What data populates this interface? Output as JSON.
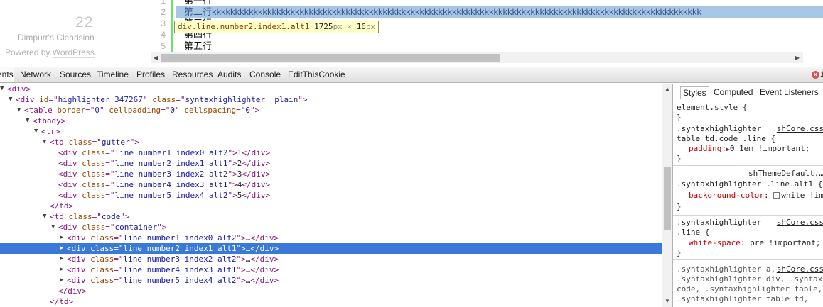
{
  "sidebar": {
    "count": "22",
    "site_name": "Dimpurr's Clearision",
    "powered_prefix": "Powered by ",
    "powered_link": "WordPress"
  },
  "code_box": {
    "line_numbers": [
      "1",
      "2",
      "3",
      "4",
      "5"
    ],
    "lines": [
      "第一行",
      "第二行kkkkkkkkkkkkkkkkkkkkkkkkkkkkkkkkkkkkkkkkkkkkkkkkkkkkkkkkkkkkkkkkkkkkkkkkkkkkkkkkkkkkkkkkkkkkkkkkkkkkkkkkkk",
      "第三行",
      "第四行",
      "第五行"
    ],
    "horizontal_scroll_fraction": 0.52
  },
  "tooltip": {
    "selector": "div.line.number2.index1.alt1",
    "width": "1725",
    "width_unit": "px",
    "times": "×",
    "height": "16",
    "height_unit": "px"
  },
  "devtools": {
    "tabs": [
      "ents",
      "Network",
      "Sources",
      "Timeline",
      "Profiles",
      "Resources",
      "Audits",
      "Console",
      "EditThisCookie"
    ],
    "error_count": "1",
    "dom_rows": [
      {
        "triangle": "open",
        "parts": [
          [
            "tg",
            "<div>"
          ]
        ]
      },
      {
        "triangle": "open",
        "parts": [
          [
            "tg",
            "<div "
          ],
          [
            "an",
            "id"
          ],
          [
            "tg",
            "=\""
          ],
          [
            "av",
            "highlighter_347267"
          ],
          [
            "tg",
            "\" "
          ],
          [
            "an",
            "class"
          ],
          [
            "tg",
            "=\""
          ],
          [
            "av",
            "syntaxhighlighter  plain"
          ],
          [
            "tg",
            "\">"
          ]
        ]
      },
      {
        "triangle": "open",
        "parts": [
          [
            "tg",
            "<table "
          ],
          [
            "an",
            "border"
          ],
          [
            "tg",
            "=\""
          ],
          [
            "av",
            "0"
          ],
          [
            "tg",
            "\" "
          ],
          [
            "an",
            "cellpadding"
          ],
          [
            "tg",
            "=\""
          ],
          [
            "av",
            "0"
          ],
          [
            "tg",
            "\" "
          ],
          [
            "an",
            "cellspacing"
          ],
          [
            "tg",
            "=\""
          ],
          [
            "av",
            "0"
          ],
          [
            "tg",
            "\">"
          ]
        ]
      },
      {
        "triangle": "open",
        "parts": [
          [
            "tg",
            "<tbody>"
          ]
        ]
      },
      {
        "triangle": "open",
        "parts": [
          [
            "tg",
            "<tr>"
          ]
        ]
      },
      {
        "triangle": "open",
        "parts": [
          [
            "tg",
            "<td "
          ],
          [
            "an",
            "class"
          ],
          [
            "tg",
            "=\""
          ],
          [
            "av",
            "gutter"
          ],
          [
            "tg",
            "\">"
          ]
        ]
      },
      {
        "triangle": "none",
        "parts": [
          [
            "tg",
            "<div "
          ],
          [
            "an",
            "class"
          ],
          [
            "tg",
            "=\""
          ],
          [
            "av",
            "line number1 index0 alt2"
          ],
          [
            "tg",
            "\">"
          ],
          [
            "tx",
            "1"
          ],
          [
            "tg",
            "</div>"
          ]
        ]
      },
      {
        "triangle": "none",
        "parts": [
          [
            "tg",
            "<div "
          ],
          [
            "an",
            "class"
          ],
          [
            "tg",
            "=\""
          ],
          [
            "av",
            "line number2 index1 alt1"
          ],
          [
            "tg",
            "\">"
          ],
          [
            "tx",
            "2"
          ],
          [
            "tg",
            "</div>"
          ]
        ]
      },
      {
        "triangle": "none",
        "parts": [
          [
            "tg",
            "<div "
          ],
          [
            "an",
            "class"
          ],
          [
            "tg",
            "=\""
          ],
          [
            "av",
            "line number3 index2 alt2"
          ],
          [
            "tg",
            "\">"
          ],
          [
            "tx",
            "3"
          ],
          [
            "tg",
            "</div>"
          ]
        ]
      },
      {
        "triangle": "none",
        "parts": [
          [
            "tg",
            "<div "
          ],
          [
            "an",
            "class"
          ],
          [
            "tg",
            "=\""
          ],
          [
            "av",
            "line number4 index3 alt1"
          ],
          [
            "tg",
            "\">"
          ],
          [
            "tx",
            "4"
          ],
          [
            "tg",
            "</div>"
          ]
        ]
      },
      {
        "triangle": "none",
        "parts": [
          [
            "tg",
            "<div "
          ],
          [
            "an",
            "class"
          ],
          [
            "tg",
            "=\""
          ],
          [
            "av",
            "line number5 index4 alt2"
          ],
          [
            "tg",
            "\">"
          ],
          [
            "tx",
            "5"
          ],
          [
            "tg",
            "</div>"
          ]
        ]
      },
      {
        "triangle": "none",
        "parts": [
          [
            "tg",
            "</td>"
          ]
        ]
      },
      {
        "triangle": "open",
        "parts": [
          [
            "tg",
            "<td "
          ],
          [
            "an",
            "class"
          ],
          [
            "tg",
            "=\""
          ],
          [
            "av",
            "code"
          ],
          [
            "tg",
            "\">"
          ]
        ]
      },
      {
        "triangle": "open",
        "parts": [
          [
            "tg",
            "<div "
          ],
          [
            "an",
            "class"
          ],
          [
            "tg",
            "=\""
          ],
          [
            "av",
            "container"
          ],
          [
            "tg",
            "\">"
          ]
        ]
      },
      {
        "triangle": "closed",
        "parts": [
          [
            "tg",
            "<div "
          ],
          [
            "an",
            "class"
          ],
          [
            "tg",
            "=\""
          ],
          [
            "av",
            "line number1 index0 alt2"
          ],
          [
            "tg",
            "\">"
          ],
          [
            "tx",
            "…"
          ],
          [
            "tg",
            "</div>"
          ]
        ]
      },
      {
        "triangle": "closed",
        "selected": true,
        "parts": [
          [
            "tg",
            "<div "
          ],
          [
            "an",
            "class"
          ],
          [
            "tg",
            "=\""
          ],
          [
            "av",
            "line number2 index1 alt1"
          ],
          [
            "tg",
            "\">"
          ],
          [
            "tx",
            "…"
          ],
          [
            "tg",
            "</div>"
          ]
        ]
      },
      {
        "triangle": "closed",
        "parts": [
          [
            "tg",
            "<div "
          ],
          [
            "an",
            "class"
          ],
          [
            "tg",
            "=\""
          ],
          [
            "av",
            "line number3 index2 alt2"
          ],
          [
            "tg",
            "\">"
          ],
          [
            "tx",
            "…"
          ],
          [
            "tg",
            "</div>"
          ]
        ]
      },
      {
        "triangle": "closed",
        "parts": [
          [
            "tg",
            "<div "
          ],
          [
            "an",
            "class"
          ],
          [
            "tg",
            "=\""
          ],
          [
            "av",
            "line number4 index3 alt1"
          ],
          [
            "tg",
            "\">"
          ],
          [
            "tx",
            "…"
          ],
          [
            "tg",
            "</div>"
          ]
        ]
      },
      {
        "triangle": "closed",
        "parts": [
          [
            "tg",
            "<div "
          ],
          [
            "an",
            "class"
          ],
          [
            "tg",
            "=\""
          ],
          [
            "av",
            "line number5 index4 alt2"
          ],
          [
            "tg",
            "\">"
          ],
          [
            "tx",
            "…"
          ],
          [
            "tg",
            "</div>"
          ]
        ]
      },
      {
        "triangle": "none",
        "parts": [
          [
            "tg",
            "</div>"
          ]
        ]
      },
      {
        "triangle": "none",
        "parts": [
          [
            "tg",
            "</td>"
          ]
        ]
      }
    ],
    "styles": {
      "tabs": [
        "Styles",
        "Computed",
        "Event Listeners"
      ],
      "element_style_selector": "element.style {",
      "close_brace": "}",
      "rule1": {
        "selector_a": ".syntaxhighlighter",
        "selector_b": "table td.code .line {",
        "source": "shCore.css",
        "property": "padding",
        "value": "0 1em !important;"
      },
      "rule2": {
        "source": "shThemeDefault.…",
        "selector": ".syntaxhighlighter .line.alt1 {",
        "property": "background-color",
        "value": "white !important;",
        "swatch_color": "#ffffff"
      },
      "rule3": {
        "selector_a": ".syntaxhighlighter",
        "selector_b": ".line {",
        "source": "shCore.css",
        "property": "white-space",
        "value": "pre !important;"
      },
      "rule4": {
        "lines": [
          ".syntaxhighlighter a,",
          ".syntaxhighlighter div, .syntaxh",
          "code, .syntaxhighlighter table,",
          ".syntaxhighlighter table td,"
        ],
        "source": "shCore.css"
      }
    }
  }
}
